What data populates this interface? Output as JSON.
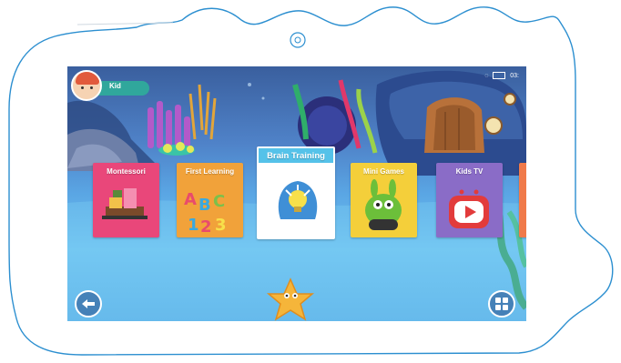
{
  "profile": {
    "name": "Kid"
  },
  "status": {
    "time": "03:"
  },
  "categories": [
    {
      "label": "Montessori",
      "color": "#e9477a"
    },
    {
      "label": "First Learning",
      "color": "#f1a23a"
    },
    {
      "label": "Brain Training",
      "color": "#55c2e9"
    },
    {
      "label": "Mini Games",
      "color": "#f4cf3a"
    },
    {
      "label": "Kids TV",
      "color": "#8a6cc7"
    }
  ],
  "icons": {
    "back": "back-arrow-icon",
    "apps": "grid-icon",
    "camera": "camera-icon",
    "wifi": "wifi-icon",
    "battery": "battery-icon"
  }
}
